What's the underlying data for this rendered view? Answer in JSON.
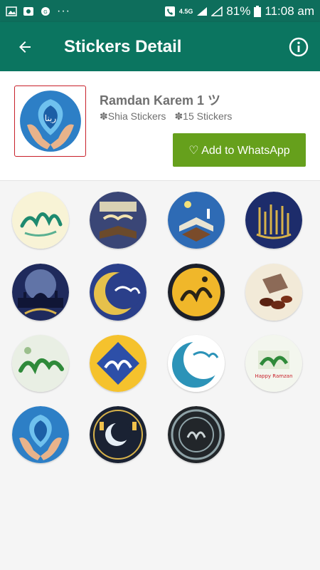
{
  "status_bar": {
    "network": "4.5G",
    "battery": "81%",
    "time": "11:08 am"
  },
  "app_bar": {
    "title": "Stickers Detail",
    "back_icon": "arrow-back-icon",
    "info_icon": "info-icon"
  },
  "pack": {
    "name": "Ramdan Karem 1 ツ",
    "publisher": "✽Shia Stickers",
    "count": "✽15 Stickers",
    "add_button": "♡ Add to WhatsApp",
    "button_color": "#66a01c"
  },
  "stickers": [
    {
      "id": 1,
      "theme": "cream-calligraphy"
    },
    {
      "id": 2,
      "theme": "dark-blue-quran"
    },
    {
      "id": 3,
      "theme": "blue-quran"
    },
    {
      "id": 4,
      "theme": "navy-gold-calligraphy"
    },
    {
      "id": 5,
      "theme": "night-mosque"
    },
    {
      "id": 6,
      "theme": "gold-crescent"
    },
    {
      "id": 7,
      "theme": "dark-gold-calligraphy"
    },
    {
      "id": 8,
      "theme": "cream-quran-dates"
    },
    {
      "id": 9,
      "theme": "green-calligraphy"
    },
    {
      "id": 10,
      "theme": "blue-yellow-calligraphy"
    },
    {
      "id": 11,
      "theme": "teal-crescent"
    },
    {
      "id": 12,
      "theme": "happy-ramzan"
    },
    {
      "id": 13,
      "theme": "hands-prayer"
    },
    {
      "id": 14,
      "theme": "lanterns-crescent"
    },
    {
      "id": 15,
      "theme": "ornate-medallion"
    }
  ],
  "sticker_label_12": "Happy Ramzan"
}
